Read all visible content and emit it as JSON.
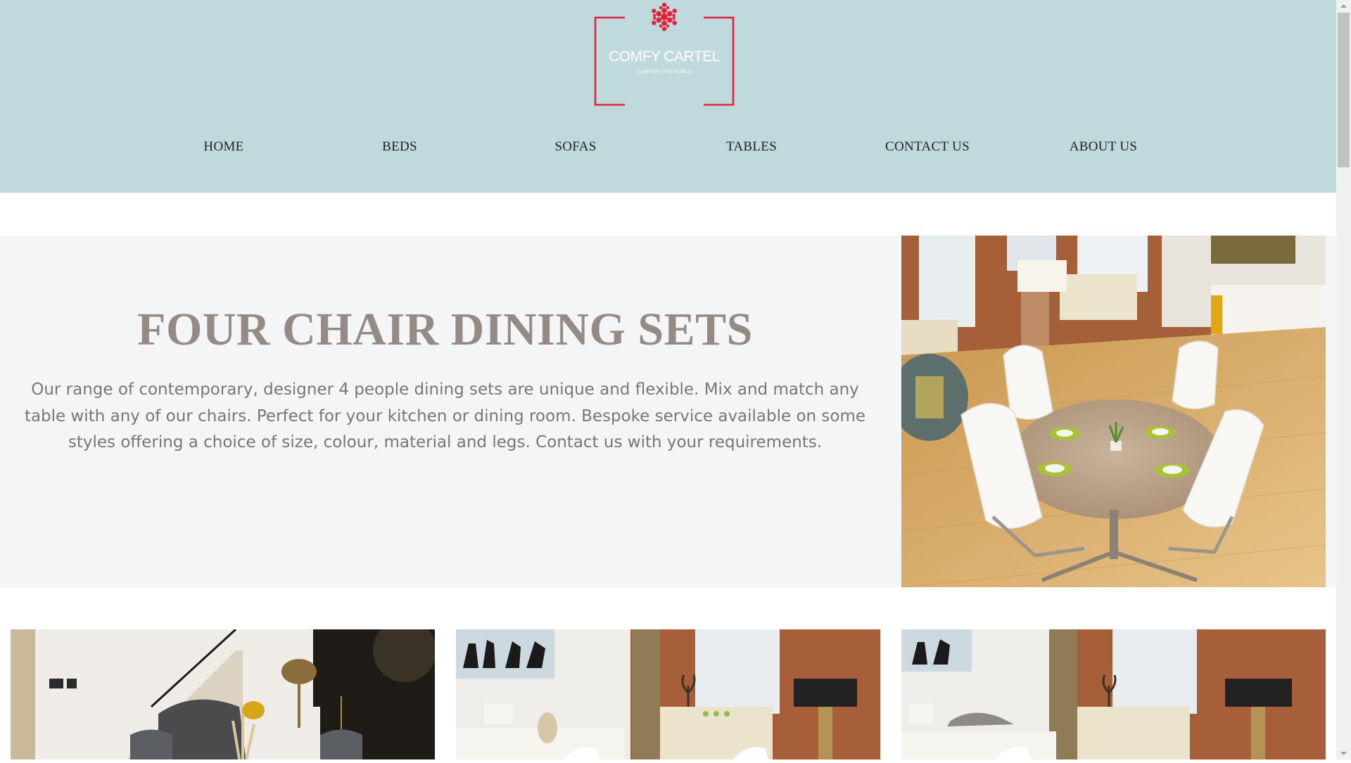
{
  "brand": {
    "name": "COMFY CARTEL",
    "tagline": "COMFORT THE WORLD",
    "accent_color": "#e0233a",
    "header_color": "#c0d9dc"
  },
  "nav": {
    "items": [
      {
        "label": "HOME"
      },
      {
        "label": "BEDS"
      },
      {
        "label": "SOFAS"
      },
      {
        "label": "TABLES"
      },
      {
        "label": "CONTACT US"
      },
      {
        "label": "ABOUT US"
      }
    ]
  },
  "hero": {
    "title": "FOUR CHAIR DINING SETS",
    "description": "Our range of contemporary, designer 4 people dining sets are unique and flexible. Mix and match any table with any of our chairs. Perfect for your kitchen or dining room. Bespoke service available on some styles offering a choice of size, colour, material and legs. Contact us with your requirements."
  }
}
